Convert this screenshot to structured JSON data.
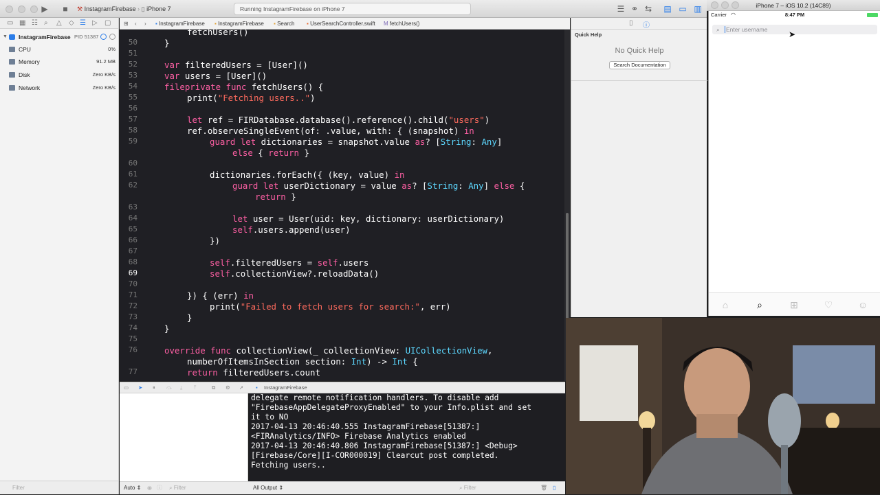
{
  "toolbar": {
    "scheme": "InstagramFirebase",
    "device": "iPhone 7",
    "status": "Running InstagramFirebase on iPhone 7"
  },
  "navigator": {
    "process": "InstagramFirebase",
    "pid": "PID 51387",
    "gauges": [
      {
        "label": "CPU",
        "value": "0%"
      },
      {
        "label": "Memory",
        "value": "91.2 MB"
      },
      {
        "label": "Disk",
        "value": "Zero KB/s"
      },
      {
        "label": "Network",
        "value": "Zero KB/s"
      }
    ],
    "filter_placeholder": "Filter"
  },
  "jumpbar": [
    "InstagramFirebase",
    "InstagramFirebase",
    "Search",
    "UserSearchController.swift",
    "fetchUsers()"
  ],
  "editor": {
    "current_line": 69,
    "lines": [
      {
        "n": "",
        "indent": 2,
        "t": [
          [
            "p",
            "fetchUsers()"
          ]
        ]
      },
      {
        "n": "50",
        "indent": 1,
        "t": [
          [
            "p",
            "}"
          ]
        ]
      },
      {
        "n": "51",
        "indent": 0,
        "t": []
      },
      {
        "n": "52",
        "indent": 1,
        "t": [
          [
            "k",
            "var"
          ],
          [
            "p",
            " filteredUsers = [User]()"
          ]
        ]
      },
      {
        "n": "53",
        "indent": 1,
        "t": [
          [
            "k",
            "var"
          ],
          [
            "p",
            " users = [User]()"
          ]
        ]
      },
      {
        "n": "54",
        "indent": 1,
        "t": [
          [
            "k",
            "fileprivate"
          ],
          [
            "p",
            " "
          ],
          [
            "k",
            "func"
          ],
          [
            "p",
            " fetchUsers() {"
          ]
        ]
      },
      {
        "n": "55",
        "indent": 2,
        "t": [
          [
            "p",
            "print("
          ],
          [
            "s",
            "\"Fetching users..\""
          ],
          [
            "p",
            ")"
          ]
        ]
      },
      {
        "n": "56",
        "indent": 0,
        "t": []
      },
      {
        "n": "57",
        "indent": 2,
        "t": [
          [
            "k",
            "let"
          ],
          [
            "p",
            " ref = FIRDatabase.database().reference().child("
          ],
          [
            "s",
            "\"users\""
          ],
          [
            "p",
            ")"
          ]
        ]
      },
      {
        "n": "58",
        "indent": 2,
        "t": [
          [
            "p",
            "ref.observeSingleEvent(of: .value, with: { (snapshot) "
          ],
          [
            "k",
            "in"
          ]
        ]
      },
      {
        "n": "59",
        "indent": 3,
        "t": [
          [
            "k",
            "guard"
          ],
          [
            "p",
            " "
          ],
          [
            "k",
            "let"
          ],
          [
            "p",
            " dictionaries = snapshot.value "
          ],
          [
            "k",
            "as"
          ],
          [
            "p",
            "? ["
          ],
          [
            "y",
            "String"
          ],
          [
            "p",
            ": "
          ],
          [
            "y",
            "Any"
          ],
          [
            "p",
            "]"
          ]
        ]
      },
      {
        "n": "",
        "indent": 4,
        "t": [
          [
            "k",
            "else"
          ],
          [
            "p",
            " { "
          ],
          [
            "k",
            "return"
          ],
          [
            "p",
            " }"
          ]
        ]
      },
      {
        "n": "60",
        "indent": 0,
        "t": []
      },
      {
        "n": "61",
        "indent": 3,
        "t": [
          [
            "p",
            "dictionaries.forEach({ (key, value) "
          ],
          [
            "k",
            "in"
          ]
        ]
      },
      {
        "n": "62",
        "indent": 4,
        "t": [
          [
            "k",
            "guard"
          ],
          [
            "p",
            " "
          ],
          [
            "k",
            "let"
          ],
          [
            "p",
            " userDictionary = value "
          ],
          [
            "k",
            "as"
          ],
          [
            "p",
            "? ["
          ],
          [
            "y",
            "String"
          ],
          [
            "p",
            ": "
          ],
          [
            "y",
            "Any"
          ],
          [
            "p",
            "] "
          ],
          [
            "k",
            "else"
          ],
          [
            "p",
            " {"
          ]
        ]
      },
      {
        "n": "",
        "indent": 5,
        "t": [
          [
            "k",
            "return"
          ],
          [
            "p",
            " }"
          ]
        ]
      },
      {
        "n": "63",
        "indent": 0,
        "t": []
      },
      {
        "n": "64",
        "indent": 4,
        "t": [
          [
            "k",
            "let"
          ],
          [
            "p",
            " user = User(uid: key, dictionary: userDictionary)"
          ]
        ]
      },
      {
        "n": "65",
        "indent": 4,
        "t": [
          [
            "k",
            "self"
          ],
          [
            "p",
            ".users.append(user)"
          ]
        ]
      },
      {
        "n": "66",
        "indent": 3,
        "t": [
          [
            "p",
            "})"
          ]
        ]
      },
      {
        "n": "67",
        "indent": 0,
        "t": []
      },
      {
        "n": "68",
        "indent": 3,
        "t": [
          [
            "k",
            "self"
          ],
          [
            "p",
            ".filteredUsers = "
          ],
          [
            "k",
            "self"
          ],
          [
            "p",
            ".users"
          ]
        ]
      },
      {
        "n": "69",
        "indent": 3,
        "t": [
          [
            "k",
            "self"
          ],
          [
            "p",
            ".collectionView?.reloadData()"
          ]
        ]
      },
      {
        "n": "70",
        "indent": 0,
        "t": []
      },
      {
        "n": "71",
        "indent": 2,
        "t": [
          [
            "p",
            "}) { (err) "
          ],
          [
            "k",
            "in"
          ]
        ]
      },
      {
        "n": "72",
        "indent": 3,
        "t": [
          [
            "p",
            "print("
          ],
          [
            "s",
            "\"Failed to fetch users for search:\""
          ],
          [
            "p",
            ", err)"
          ]
        ]
      },
      {
        "n": "73",
        "indent": 2,
        "t": [
          [
            "p",
            "}"
          ]
        ]
      },
      {
        "n": "74",
        "indent": 1,
        "t": [
          [
            "p",
            "}"
          ]
        ]
      },
      {
        "n": "75",
        "indent": 0,
        "t": []
      },
      {
        "n": "76",
        "indent": 1,
        "t": [
          [
            "k",
            "override"
          ],
          [
            "p",
            " "
          ],
          [
            "k",
            "func"
          ],
          [
            "p",
            " collectionView(_ collectionView: "
          ],
          [
            "y",
            "UICollectionView"
          ],
          [
            "p",
            ","
          ]
        ]
      },
      {
        "n": "",
        "indent": 2,
        "t": [
          [
            "p",
            "numberOfItemsInSection section: "
          ],
          [
            "y",
            "Int"
          ],
          [
            "p",
            ") -> "
          ],
          [
            "y",
            "Int"
          ],
          [
            "p",
            " {"
          ]
        ]
      },
      {
        "n": "77",
        "indent": 2,
        "t": [
          [
            "k",
            "return"
          ],
          [
            "p",
            " filteredUsers.count"
          ]
        ]
      }
    ]
  },
  "inspector": {
    "section_title": "Quick Help",
    "empty_text": "No Quick Help",
    "search_button": "Search Documentation"
  },
  "debug": {
    "target": "InstagramFirebase",
    "console": "delegate remote notification handlers. To disable add\n\"FirebaseAppDelegateProxyEnabled\" to your Info.plist and set\nit to NO\n2017-04-13 20:46:40.555 InstagramFirebase[51387:]\n<FIRAnalytics/INFO> Firebase Analytics enabled\n2017-04-13 20:46:40.806 InstagramFirebase[51387:] <Debug>\n[Firebase/Core][I-COR000019] Clearcut post completed.\nFetching users..",
    "auto_label": "Auto",
    "output_select": "All Output",
    "filter_placeholder": "Filter"
  },
  "simulator": {
    "title": "iPhone 7 – iOS 10.2 (14C89)",
    "carrier": "Carrier",
    "time": "8:47 PM",
    "search_placeholder": "Enter username"
  },
  "colors": {
    "editor_bg": "#1f1f24",
    "keyword": "#fc5fa3",
    "type": "#5dd8ff",
    "string": "#fc6a5d",
    "accent": "#2b7de9"
  }
}
